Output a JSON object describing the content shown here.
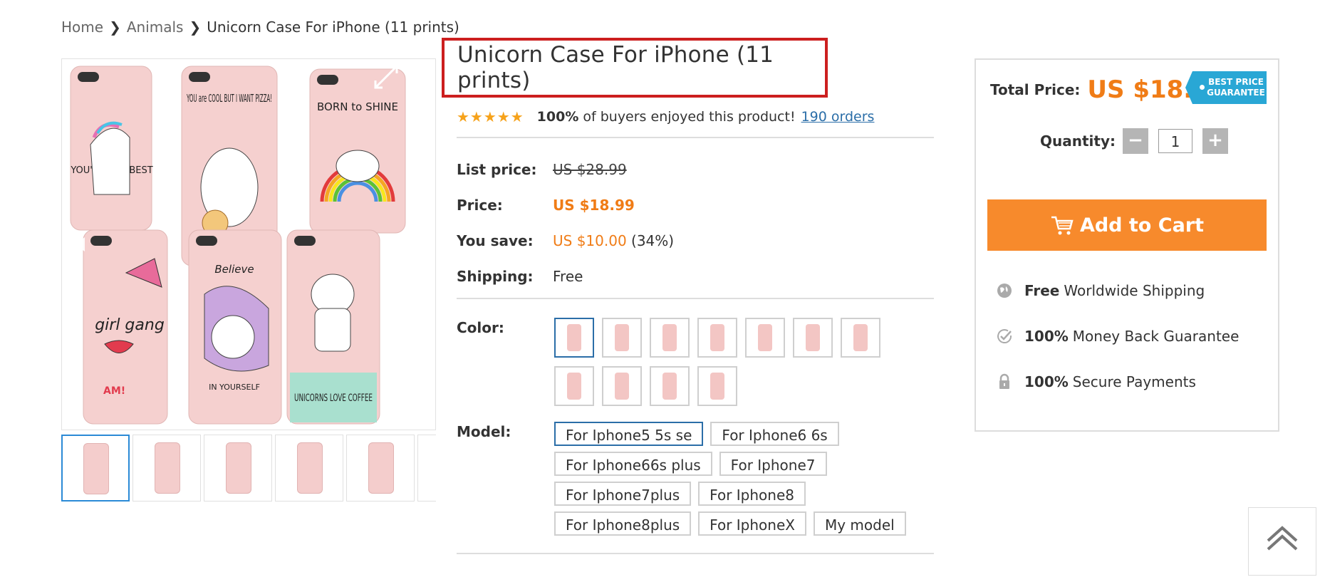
{
  "breadcrumb": {
    "home": "Home",
    "category": "Animals",
    "current": "Unicorn Case For iPhone (11 prints)"
  },
  "product": {
    "title": "Unicorn Case For iPhone (11 prints)",
    "rating_percent": "100%",
    "rating_text": "of buyers enjoyed this product!",
    "orders": "190 orders",
    "stars": 5
  },
  "pricing": {
    "list_label": "List price:",
    "list_value": "US $28.99",
    "price_label": "Price:",
    "price_value": "US $18.99",
    "save_label": "You save:",
    "save_value": "US $10.00",
    "save_percent": "(34%)",
    "shipping_label": "Shipping:",
    "shipping_value": "Free"
  },
  "options": {
    "color_label": "Color:",
    "color_count": 11,
    "model_label": "Model:",
    "models": [
      "For Iphone5 5s se",
      "For Iphone6 6s",
      "For Iphone66s plus",
      "For Iphone7",
      "For Iphone7plus",
      "For Iphone8",
      "For Iphone8plus",
      "For IphoneX",
      "My model"
    ]
  },
  "gallery": {
    "texts": {
      "t1": "YOU'RE THE BEST",
      "t2": "YOU are COOL BUT I WANT PIZZA!",
      "t3": "BORN to SHINE",
      "t4": "girl gang",
      "t5": "Believe",
      "t6": "IN YOURSELF",
      "t7": "UNICORNS LOVE COFFEE",
      "t8": "AM!"
    }
  },
  "panel": {
    "total_label": "Total Price:",
    "total_value": "US $18.99",
    "badge_line1": "BEST PRICE",
    "badge_line2": "GUARANTEE",
    "quantity_label": "Quantity:",
    "quantity_value": "1",
    "minus": "−",
    "plus": "+",
    "add_to_cart": "Add to Cart",
    "features": [
      {
        "bold": "Free",
        "text": "Worldwide Shipping"
      },
      {
        "bold": "100%",
        "text": "Money Back Guarantee"
      },
      {
        "bold": "100%",
        "text": "Secure Payments"
      }
    ]
  },
  "colors": {
    "accent_orange": "#f07c16",
    "link_blue": "#2b6ea8",
    "title_highlight": "#cc1f1f"
  }
}
